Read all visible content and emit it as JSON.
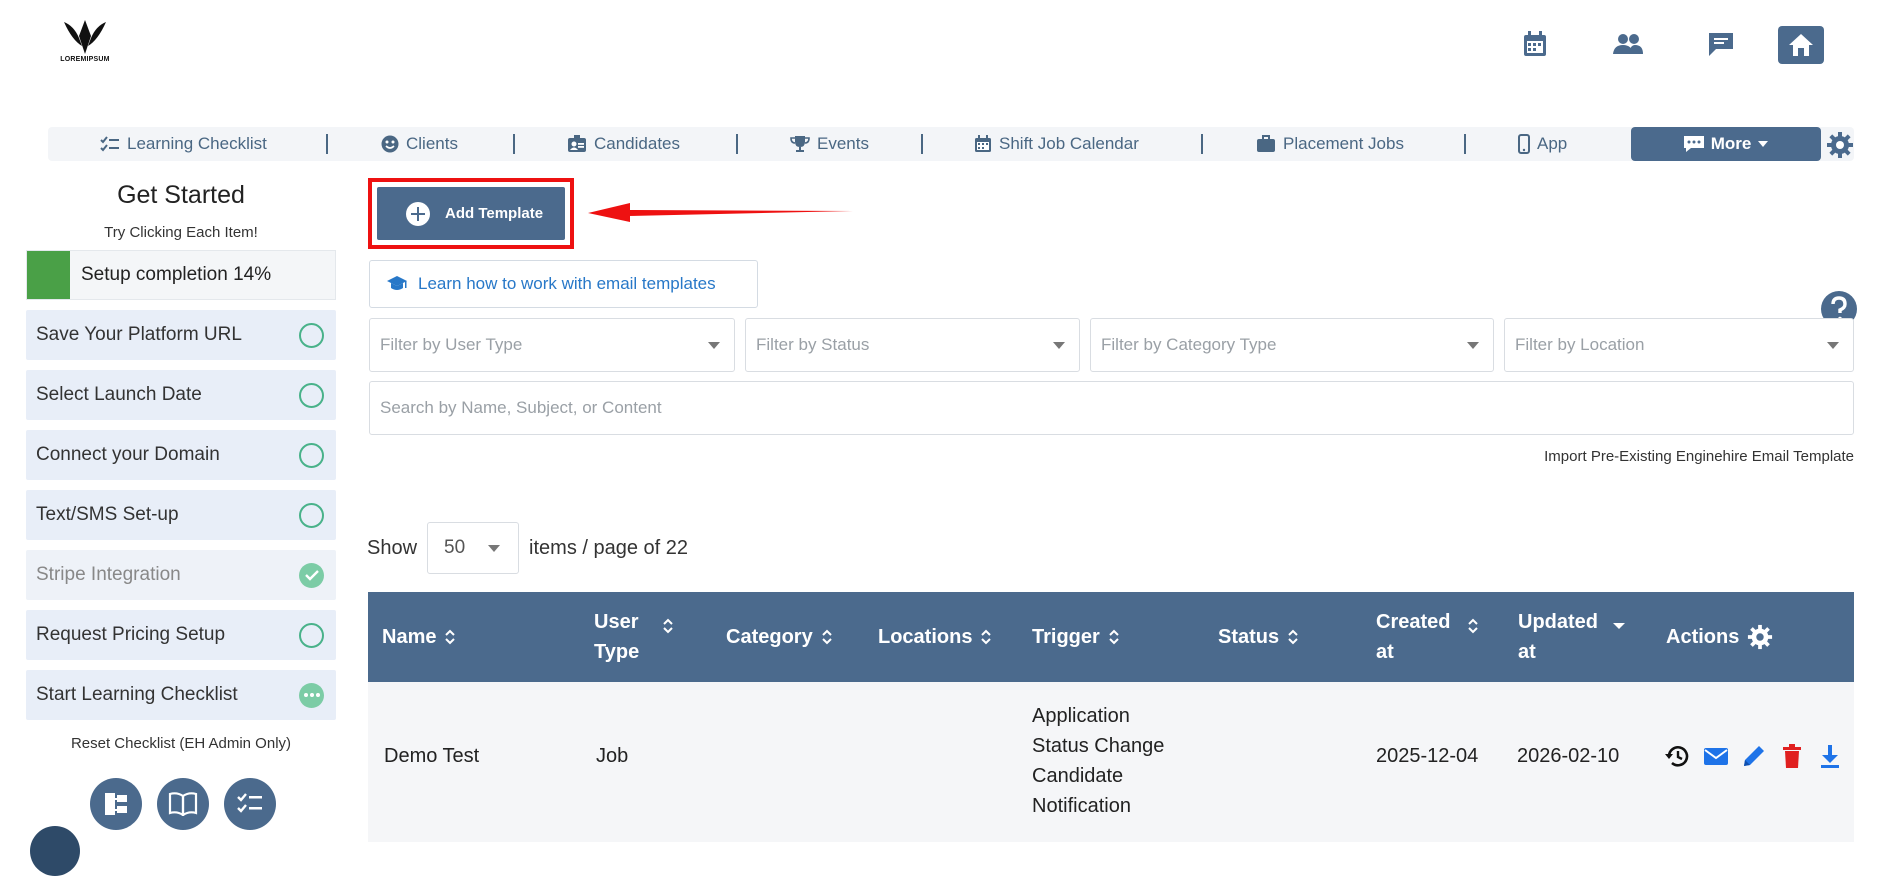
{
  "brand": {
    "logo_text": "LOREMIPSUM"
  },
  "header_icons": [
    "calendar-icon",
    "people-icon",
    "chat-icon",
    "home-icon"
  ],
  "nav": {
    "items": [
      {
        "label": "Learning Checklist",
        "icon": "checklist-icon"
      },
      {
        "label": "Clients",
        "icon": "smiley-icon"
      },
      {
        "label": "Candidates",
        "icon": "id-badge-icon"
      },
      {
        "label": "Events",
        "icon": "trophy-icon"
      },
      {
        "label": "Shift Job Calendar",
        "icon": "calendar-icon"
      },
      {
        "label": "Placement Jobs",
        "icon": "briefcase-icon"
      },
      {
        "label": "App",
        "icon": "phone-icon"
      }
    ],
    "more_label": "More"
  },
  "sidebar": {
    "title": "Get Started",
    "subtitle": "Try Clicking Each Item!",
    "progress": {
      "label": "Setup completion 14%",
      "percent": 14
    },
    "items": [
      {
        "label": "Save Your Platform URL",
        "state": "pending"
      },
      {
        "label": "Select Launch Date",
        "state": "pending"
      },
      {
        "label": "Connect your Domain",
        "state": "pending"
      },
      {
        "label": "Text/SMS Set-up",
        "state": "pending"
      },
      {
        "label": "Stripe Integration",
        "state": "done"
      },
      {
        "label": "Request Pricing Setup",
        "state": "pending"
      },
      {
        "label": "Start Learning Checklist",
        "state": "in-progress"
      }
    ],
    "reset_label": "Reset Checklist (EH Admin Only)"
  },
  "main": {
    "add_template_label": "Add Template",
    "learn_link": "Learn how to work with email templates",
    "filters": [
      {
        "placeholder": "Filter by User Type"
      },
      {
        "placeholder": "Filter by Status"
      },
      {
        "placeholder": "Filter by Category Type"
      },
      {
        "placeholder": "Filter by Location"
      }
    ],
    "search_placeholder": "Search by Name, Subject, or Content",
    "import_label": "Import Pre-Existing Enginehire Email Template",
    "pagination": {
      "show": "Show",
      "per_page": "50",
      "suffix": "items / page of 22"
    }
  },
  "table": {
    "headers": {
      "name": "Name",
      "user_type": "User Type",
      "category": "Category",
      "locations": "Locations",
      "trigger": "Trigger",
      "status": "Status",
      "created": "Created at",
      "updated": "Updated at",
      "actions": "Actions"
    },
    "rows": [
      {
        "name": "Demo Test",
        "user_type": "Job",
        "category": "",
        "locations": "",
        "trigger": "Application Status Change Candidate Notification",
        "status": "",
        "created": "2025-12-04",
        "updated": "2026-02-10"
      }
    ]
  },
  "colors": {
    "primary": "#4b6a8d",
    "highlight": "#ee1111",
    "progress": "#4aa047",
    "check": "#49b28a",
    "link": "#2878c8",
    "action_blue": "#1e73e8",
    "action_red": "#e02020"
  }
}
